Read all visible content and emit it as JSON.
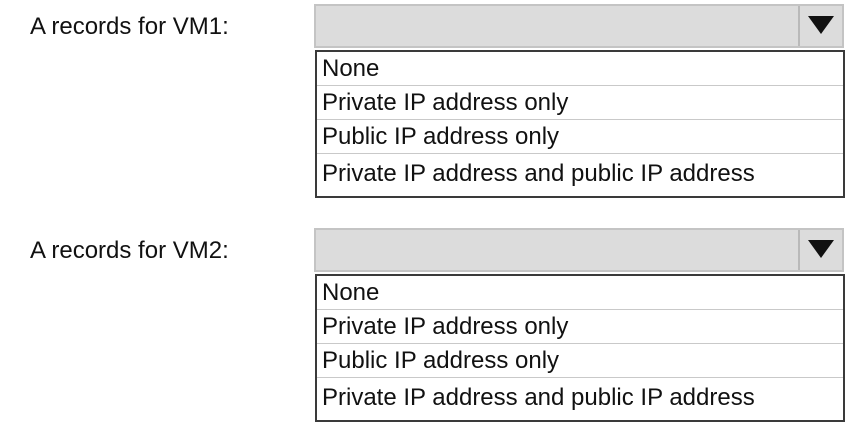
{
  "vm1": {
    "label": "A records for VM1:",
    "selected_value": "",
    "dropdown_icon": "triangle-down",
    "options": [
      "None",
      "Private IP address only",
      "Public IP address only",
      "Private IP address and public IP address"
    ]
  },
  "vm2": {
    "label": "A records for VM2:",
    "selected_value": "",
    "dropdown_icon": "triangle-down",
    "options": [
      "None",
      "Private IP address only",
      "Public IP address only",
      "Private IP address and public IP address"
    ]
  },
  "colors": {
    "select_background": "#dcdcdc",
    "list_border": "#3a3a3a",
    "arrow": "#111111"
  }
}
